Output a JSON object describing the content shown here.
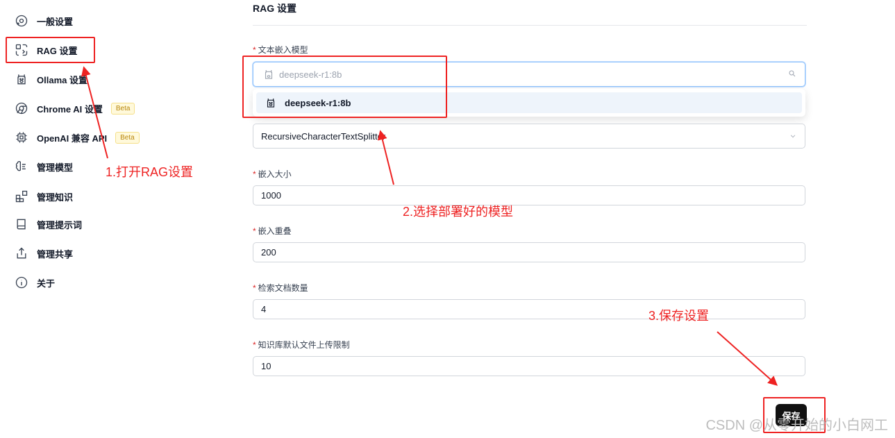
{
  "sidebar": {
    "items": [
      {
        "label": "一般设置",
        "icon": "settings-icon"
      },
      {
        "label": "RAG 设置",
        "icon": "rag-icon"
      },
      {
        "label": "Ollama 设置",
        "icon": "llama-icon"
      },
      {
        "label": "Chrome AI 设置",
        "icon": "chrome-icon",
        "badge": "Beta"
      },
      {
        "label": "OpenAI 兼容 API",
        "icon": "chip-icon",
        "badge": "Beta"
      },
      {
        "label": "管理模型",
        "icon": "brain-icon"
      },
      {
        "label": "管理知识",
        "icon": "blocks-icon"
      },
      {
        "label": "管理提示词",
        "icon": "book-icon"
      },
      {
        "label": "管理共享",
        "icon": "share-icon"
      },
      {
        "label": "关于",
        "icon": "info-icon"
      }
    ]
  },
  "main": {
    "title": "RAG 设置",
    "embedding": {
      "label": "文本嵌入模型",
      "placeholder": "deepseek-r1:8b",
      "option": "deepseek-r1:8b"
    },
    "splitter": {
      "value": "RecursiveCharacterTextSplitter"
    },
    "chunk_size": {
      "label": "嵌入大小",
      "value": "1000"
    },
    "chunk_overlap": {
      "label": "嵌入重叠",
      "value": "200"
    },
    "retrieval_count": {
      "label": "检索文档数量",
      "value": "4"
    },
    "upload_limit": {
      "label": "知识库默认文件上传限制",
      "value": "10"
    },
    "save_label": "保存"
  },
  "annotations": {
    "step1": "1.打开RAG设置",
    "step2": "2.选择部署好的模型",
    "step3": "3.保存设置"
  },
  "watermark": "CSDN @从零开始的小白网工",
  "colors": {
    "annotation": "#ee2222",
    "save_button": "#111111",
    "focus": "#93c5fd"
  }
}
